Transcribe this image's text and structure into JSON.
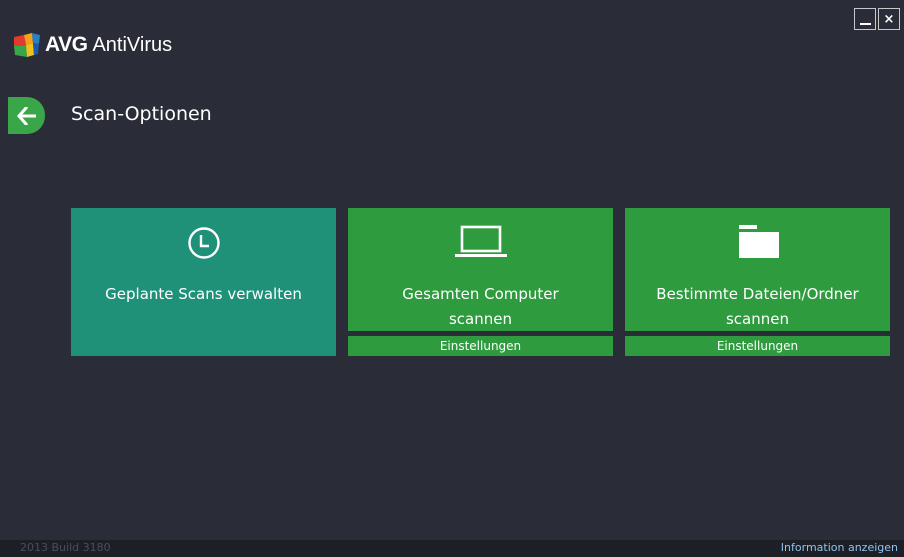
{
  "app": {
    "brand": "AVG",
    "product": "AntiVirus"
  },
  "window_controls": {
    "minimize_icon": "minimize-icon",
    "close_label": "×"
  },
  "header": {
    "back_icon": "arrow-left-icon",
    "title": "Scan-Optionen"
  },
  "tiles": [
    {
      "id": "scheduled",
      "icon": "clock-icon",
      "label": "Geplante Scans verwalten"
    },
    {
      "id": "computer",
      "icon": "laptop-icon",
      "label_line1": "Gesamten Computer",
      "label_line2": "scannen",
      "settings_label": "Einstellungen"
    },
    {
      "id": "files",
      "icon": "folder-icon",
      "label_line1": "Bestimmte Dateien/Ordner",
      "label_line2": "scannen",
      "settings_label": "Einstellungen"
    }
  ],
  "footer": {
    "version": "2013  Build 3180",
    "info_link": "Information anzeigen"
  },
  "colors": {
    "background": "#2a2d38",
    "tile_teal": "#1f9178",
    "tile_green": "#2e9b3e",
    "back_button": "#3aa64a",
    "link": "#8fc3f0"
  }
}
